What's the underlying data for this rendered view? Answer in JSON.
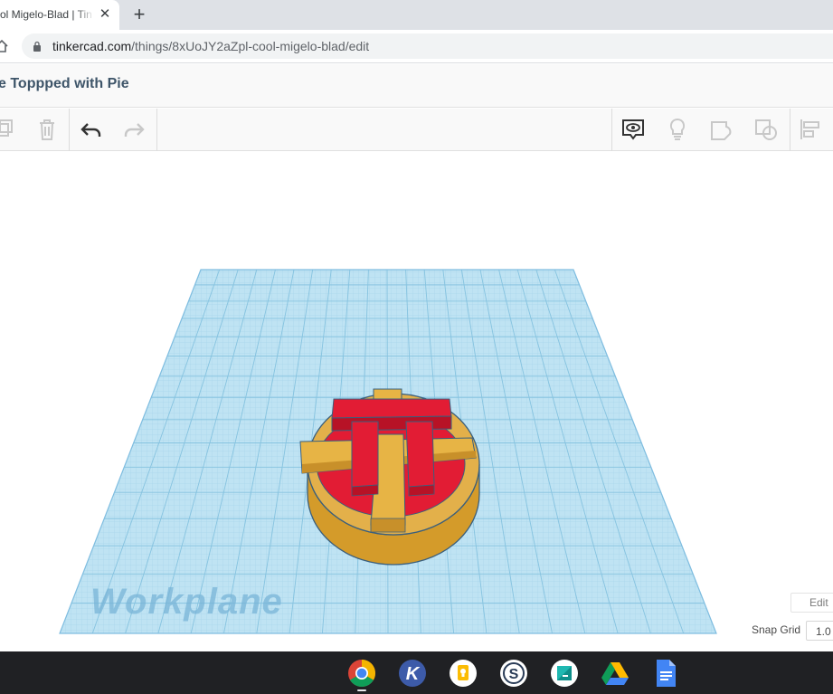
{
  "browser": {
    "tab": {
      "title": "ol Migelo-Blad | Tin",
      "close": "✕"
    },
    "new_tab": "+",
    "address": {
      "host": "tinkercad.com",
      "path": "/things/8xUoJY2aZpl-cool-migelo-blad/edit"
    }
  },
  "editor": {
    "design_title": "e Toppped with Pie",
    "toolbar": [
      "copy-icon",
      "trash-icon",
      "undo-icon",
      "redo-icon",
      "notes-visibility-icon",
      "lightbulb-icon",
      "group-icon",
      "ungroup-icon",
      "align-icon"
    ],
    "workplane_label": "Workplane",
    "edit_grid_label": "Edit",
    "snap_grid": {
      "label": "Snap Grid",
      "value": "1.0"
    }
  },
  "shelf": {
    "apps": [
      "chrome-icon",
      "k-app-icon",
      "keep-icon",
      "s-app-icon",
      "teal-app-icon",
      "drive-icon",
      "docs-icon"
    ]
  },
  "colors": {
    "workplane": "#b6dff0",
    "grid": "#8ec9e6",
    "model_gold": "#e0ab3a",
    "model_red": "#e21c34",
    "shelf_bg": "#202124"
  }
}
